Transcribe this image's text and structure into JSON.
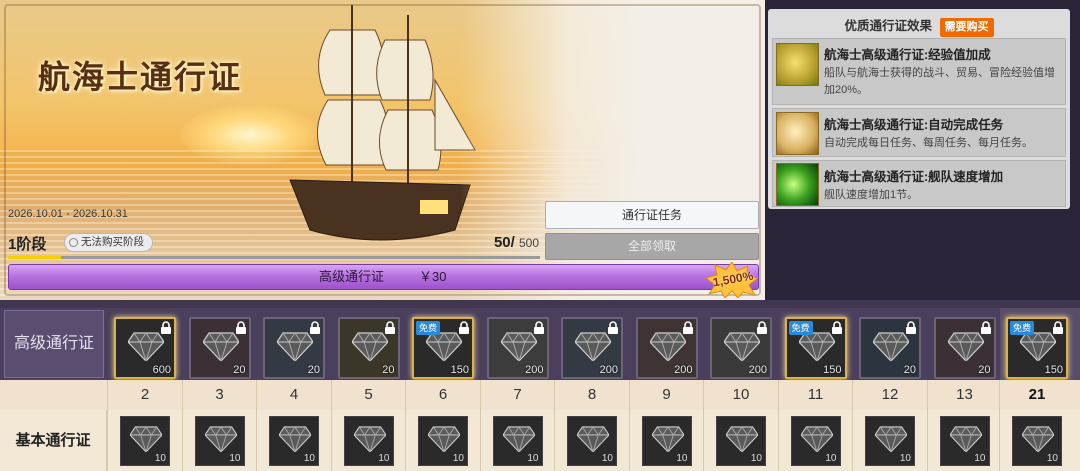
{
  "banner": {
    "title": "航海士通行证",
    "date_range": "2026.10.01 - 2026.10.31",
    "stage": "1阶段",
    "stage_pill": "无法购买阶段",
    "xp_current": "50/",
    "xp_total": "500",
    "stage_progress": 0.1
  },
  "buttons": {
    "task": "通行证任务",
    "claim_all": "全部领取"
  },
  "premium_bar": {
    "label": "高级通行证",
    "price": "￥30",
    "burst": "1,500%"
  },
  "effects": {
    "header": "优质通行证效果",
    "badge": "需要购买",
    "items": [
      {
        "title": "航海士高级通行证:经验值加成",
        "desc": "船队与航海士获得的战斗、贸易、冒险经验值增加20%。",
        "icon": "medal-icon"
      },
      {
        "title": "航海士高级通行证:自动完成任务",
        "desc": "自动完成每日任务、每周任务、每月任务。",
        "icon": "scroll-gear-icon"
      },
      {
        "title": "航海士高级通行证:舰队速度增加",
        "desc": "舰队速度增加1节。",
        "icon": "speed-swirl-icon"
      }
    ]
  },
  "track": {
    "premium_label": "高级通行证",
    "basic_label": "基本通行证",
    "free_tag": "免费",
    "levels": [
      "2",
      "3",
      "4",
      "5",
      "6",
      "7",
      "8",
      "9",
      "10",
      "11",
      "12",
      "13",
      "21"
    ],
    "premium_rewards": [
      {
        "qty": "600",
        "icon": "gem-icon",
        "free": false,
        "locked": true,
        "tint": "#2a2a2a"
      },
      {
        "qty": "20",
        "icon": "box-red-icon",
        "free": false,
        "locked": true,
        "tint": "#3a3036"
      },
      {
        "qty": "20",
        "icon": "box-blue-icon",
        "free": false,
        "locked": true,
        "tint": "#343a44"
      },
      {
        "qty": "20",
        "icon": "box-gold-icon",
        "free": false,
        "locked": true,
        "tint": "#3a3628"
      },
      {
        "qty": "150",
        "icon": "gem-icon",
        "free": true,
        "locked": true,
        "tint": "#2a2a2a"
      },
      {
        "qty": "200",
        "icon": "compass-icon",
        "free": false,
        "locked": true,
        "tint": "#3c3c3c"
      },
      {
        "qty": "200",
        "icon": "compass-icon",
        "free": false,
        "locked": true,
        "tint": "#343a44"
      },
      {
        "qty": "200",
        "icon": "compass-icon",
        "free": false,
        "locked": true,
        "tint": "#3e3434"
      },
      {
        "qty": "200",
        "icon": "compass-icon",
        "free": false,
        "locked": true,
        "tint": "#3a3a3a"
      },
      {
        "qty": "150",
        "icon": "gem-icon",
        "free": true,
        "locked": true,
        "tint": "#2a2a2a"
      },
      {
        "qty": "20",
        "icon": "box-blue-icon",
        "free": false,
        "locked": true,
        "tint": "#2c3440"
      },
      {
        "qty": "20",
        "icon": "box-red-icon",
        "free": false,
        "locked": true,
        "tint": "#3a3036"
      },
      {
        "qty": "150",
        "icon": "gem-icon",
        "free": true,
        "locked": true,
        "tint": "#2a2a2a"
      }
    ],
    "basic_rewards": [
      "10",
      "10",
      "10",
      "10",
      "10",
      "10",
      "10",
      "10",
      "10",
      "10",
      "10",
      "10",
      "10"
    ]
  }
}
